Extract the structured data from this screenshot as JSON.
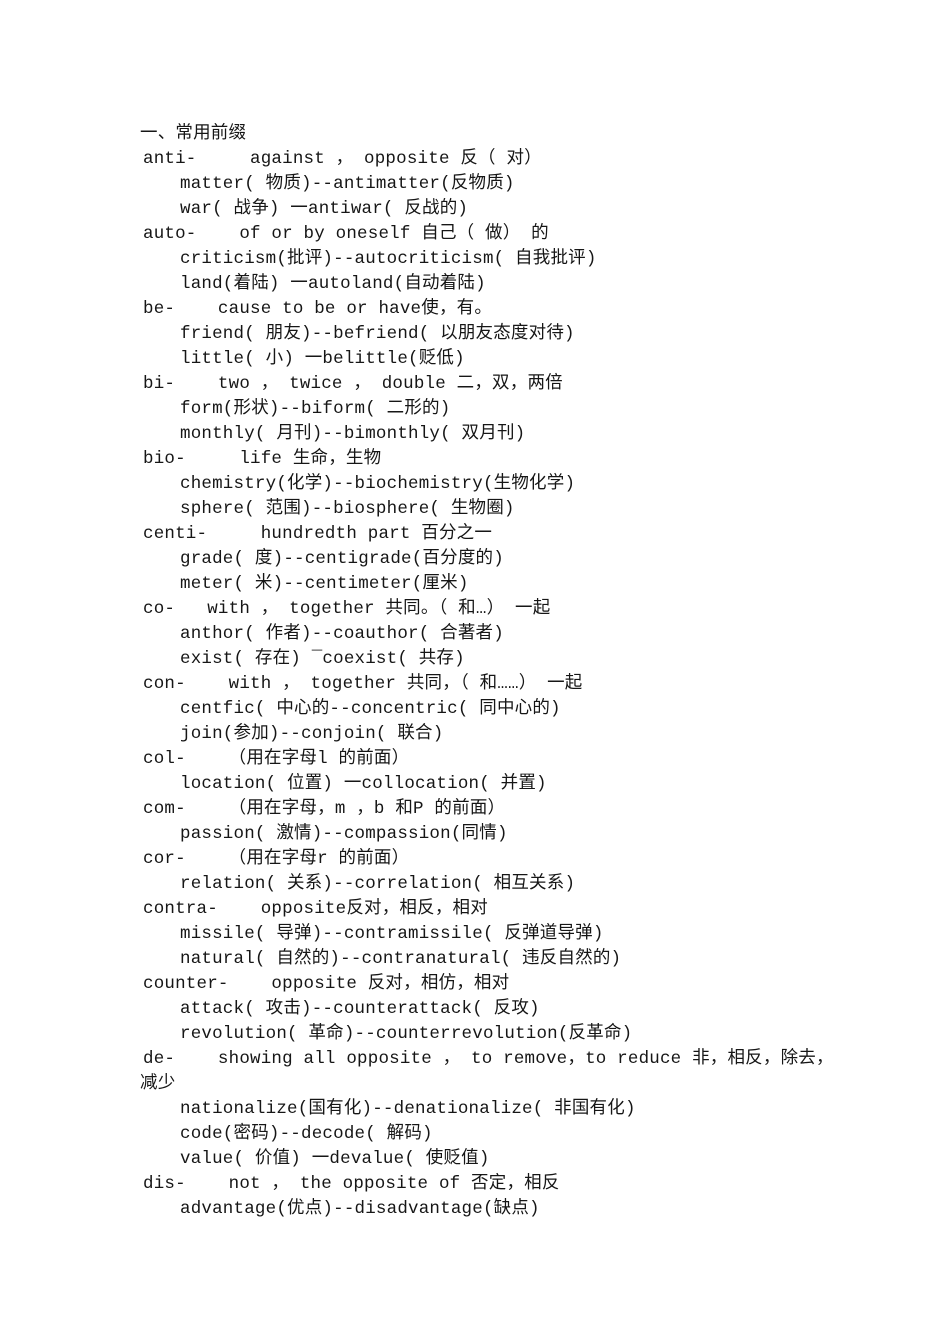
{
  "document": {
    "section_title": "一、常用前缀",
    "entries": [
      {
        "id": "anti",
        "head": "anti-     against ， opposite 反（ 对）",
        "examples": [
          "matter( 物质)--antimatter(反物质)",
          "war( 战争) 一antiwar( 反战的)"
        ]
      },
      {
        "id": "auto",
        "head": "auto-    of or by oneself 自己（ 做） 的",
        "examples": [
          "criticism(批评)--autocriticism( 自我批评)",
          "land(着陆) 一autoland(自动着陆)"
        ]
      },
      {
        "id": "be",
        "head": "be-    cause to be or have使，有。",
        "examples": [
          "friend( 朋友)--befriend( 以朋友态度对待)",
          "little( 小) 一belittle(贬低)"
        ]
      },
      {
        "id": "bi",
        "head": "bi-    two ， twice ， double 二，双，两倍",
        "examples": [
          "form(形状)--biform( 二形的)",
          "monthly( 月刊)--bimonthly( 双月刊)"
        ]
      },
      {
        "id": "bio",
        "head": "bio-     life 生命，生物",
        "examples": [
          "chemistry(化学)--biochemistry(生物化学)",
          "sphere( 范围)--biosphere( 生物圈)"
        ]
      },
      {
        "id": "centi",
        "head": "centi-     hundredth part 百分之一",
        "examples": [
          "grade( 度)--centigrade(百分度的)",
          "meter( 米)--centimeter(厘米)"
        ]
      },
      {
        "id": "co",
        "head": "co-   with ， together 共同。（ 和…） 一起",
        "examples": [
          "anthor( 作者)--coauthor( 合著者)",
          "exist( 存在) ‾coexist( 共存)"
        ]
      },
      {
        "id": "con",
        "head": "con-    with ， together 共同，（ 和……） 一起",
        "examples": [
          "centfic( 中心的--concentric( 同中心的)",
          "join(参加)--conjoin( 联合)"
        ]
      },
      {
        "id": "col",
        "head": "col-    （用在字母l 的前面）",
        "examples": [
          "location( 位置) 一collocation( 并置)"
        ]
      },
      {
        "id": "com",
        "head": "com-    （用在字母，m ，b 和P 的前面）",
        "examples": [
          "passion( 激情)--compassion(同情)"
        ]
      },
      {
        "id": "cor",
        "head": "cor-    （用在字母r 的前面）",
        "examples": [
          "relation( 关系)--correlation( 相互关系)"
        ]
      },
      {
        "id": "contra",
        "head": "contra-    opposite反对，相反，相对",
        "examples": [
          "missile( 导弹)--contramissile( 反弹道导弹)",
          "natural( 自然的)--contranatural( 违反自然的)"
        ]
      },
      {
        "id": "counter",
        "head": "counter-    opposite 反对，相仿，相对",
        "examples": [
          "attack( 攻击)--counterattack( 反攻)",
          "revolution( 革命)--counterrevolution(反革命)"
        ]
      },
      {
        "id": "de",
        "head": "de-    showing all opposite ， to remove，to reduce 非，相反，除去，",
        "head_wrap": "减少",
        "examples": [
          "nationalize(国有化)--denationalize( 非国有化)",
          "code(密码)--decode( 解码)",
          "value( 价值) 一devalue( 使贬值)"
        ]
      },
      {
        "id": "dis",
        "head": "dis-    not ， the opposite of 否定，相反",
        "examples": [
          "advantage(优点)--disadvantage(缺点)"
        ]
      }
    ]
  }
}
